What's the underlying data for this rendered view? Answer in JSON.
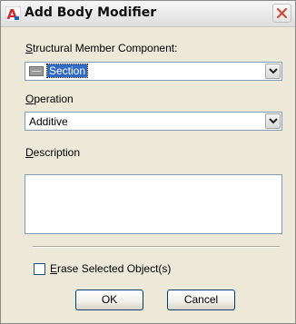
{
  "dialog": {
    "title": "Add Body Modifier",
    "app_icon": "autocad-a-icon",
    "close_icon": "close-x-icon"
  },
  "component": {
    "label_prefix": "",
    "label_key": "S",
    "label_rest": "tructural Member Component:",
    "value": "Section",
    "value_icon": "section-component-icon"
  },
  "operation": {
    "label_key": "O",
    "label_rest": "peration",
    "value": "Additive"
  },
  "description": {
    "label_key": "D",
    "label_rest": "escription",
    "value": ""
  },
  "erase": {
    "label_key": "E",
    "label_rest": "rase Selected Object(s)",
    "checked": false
  },
  "buttons": {
    "ok": "OK",
    "cancel": "Cancel"
  },
  "colors": {
    "title_icon_red": "#d22a2a",
    "close_x_red": "#d44a3a",
    "selection_blue": "#316ac5"
  }
}
